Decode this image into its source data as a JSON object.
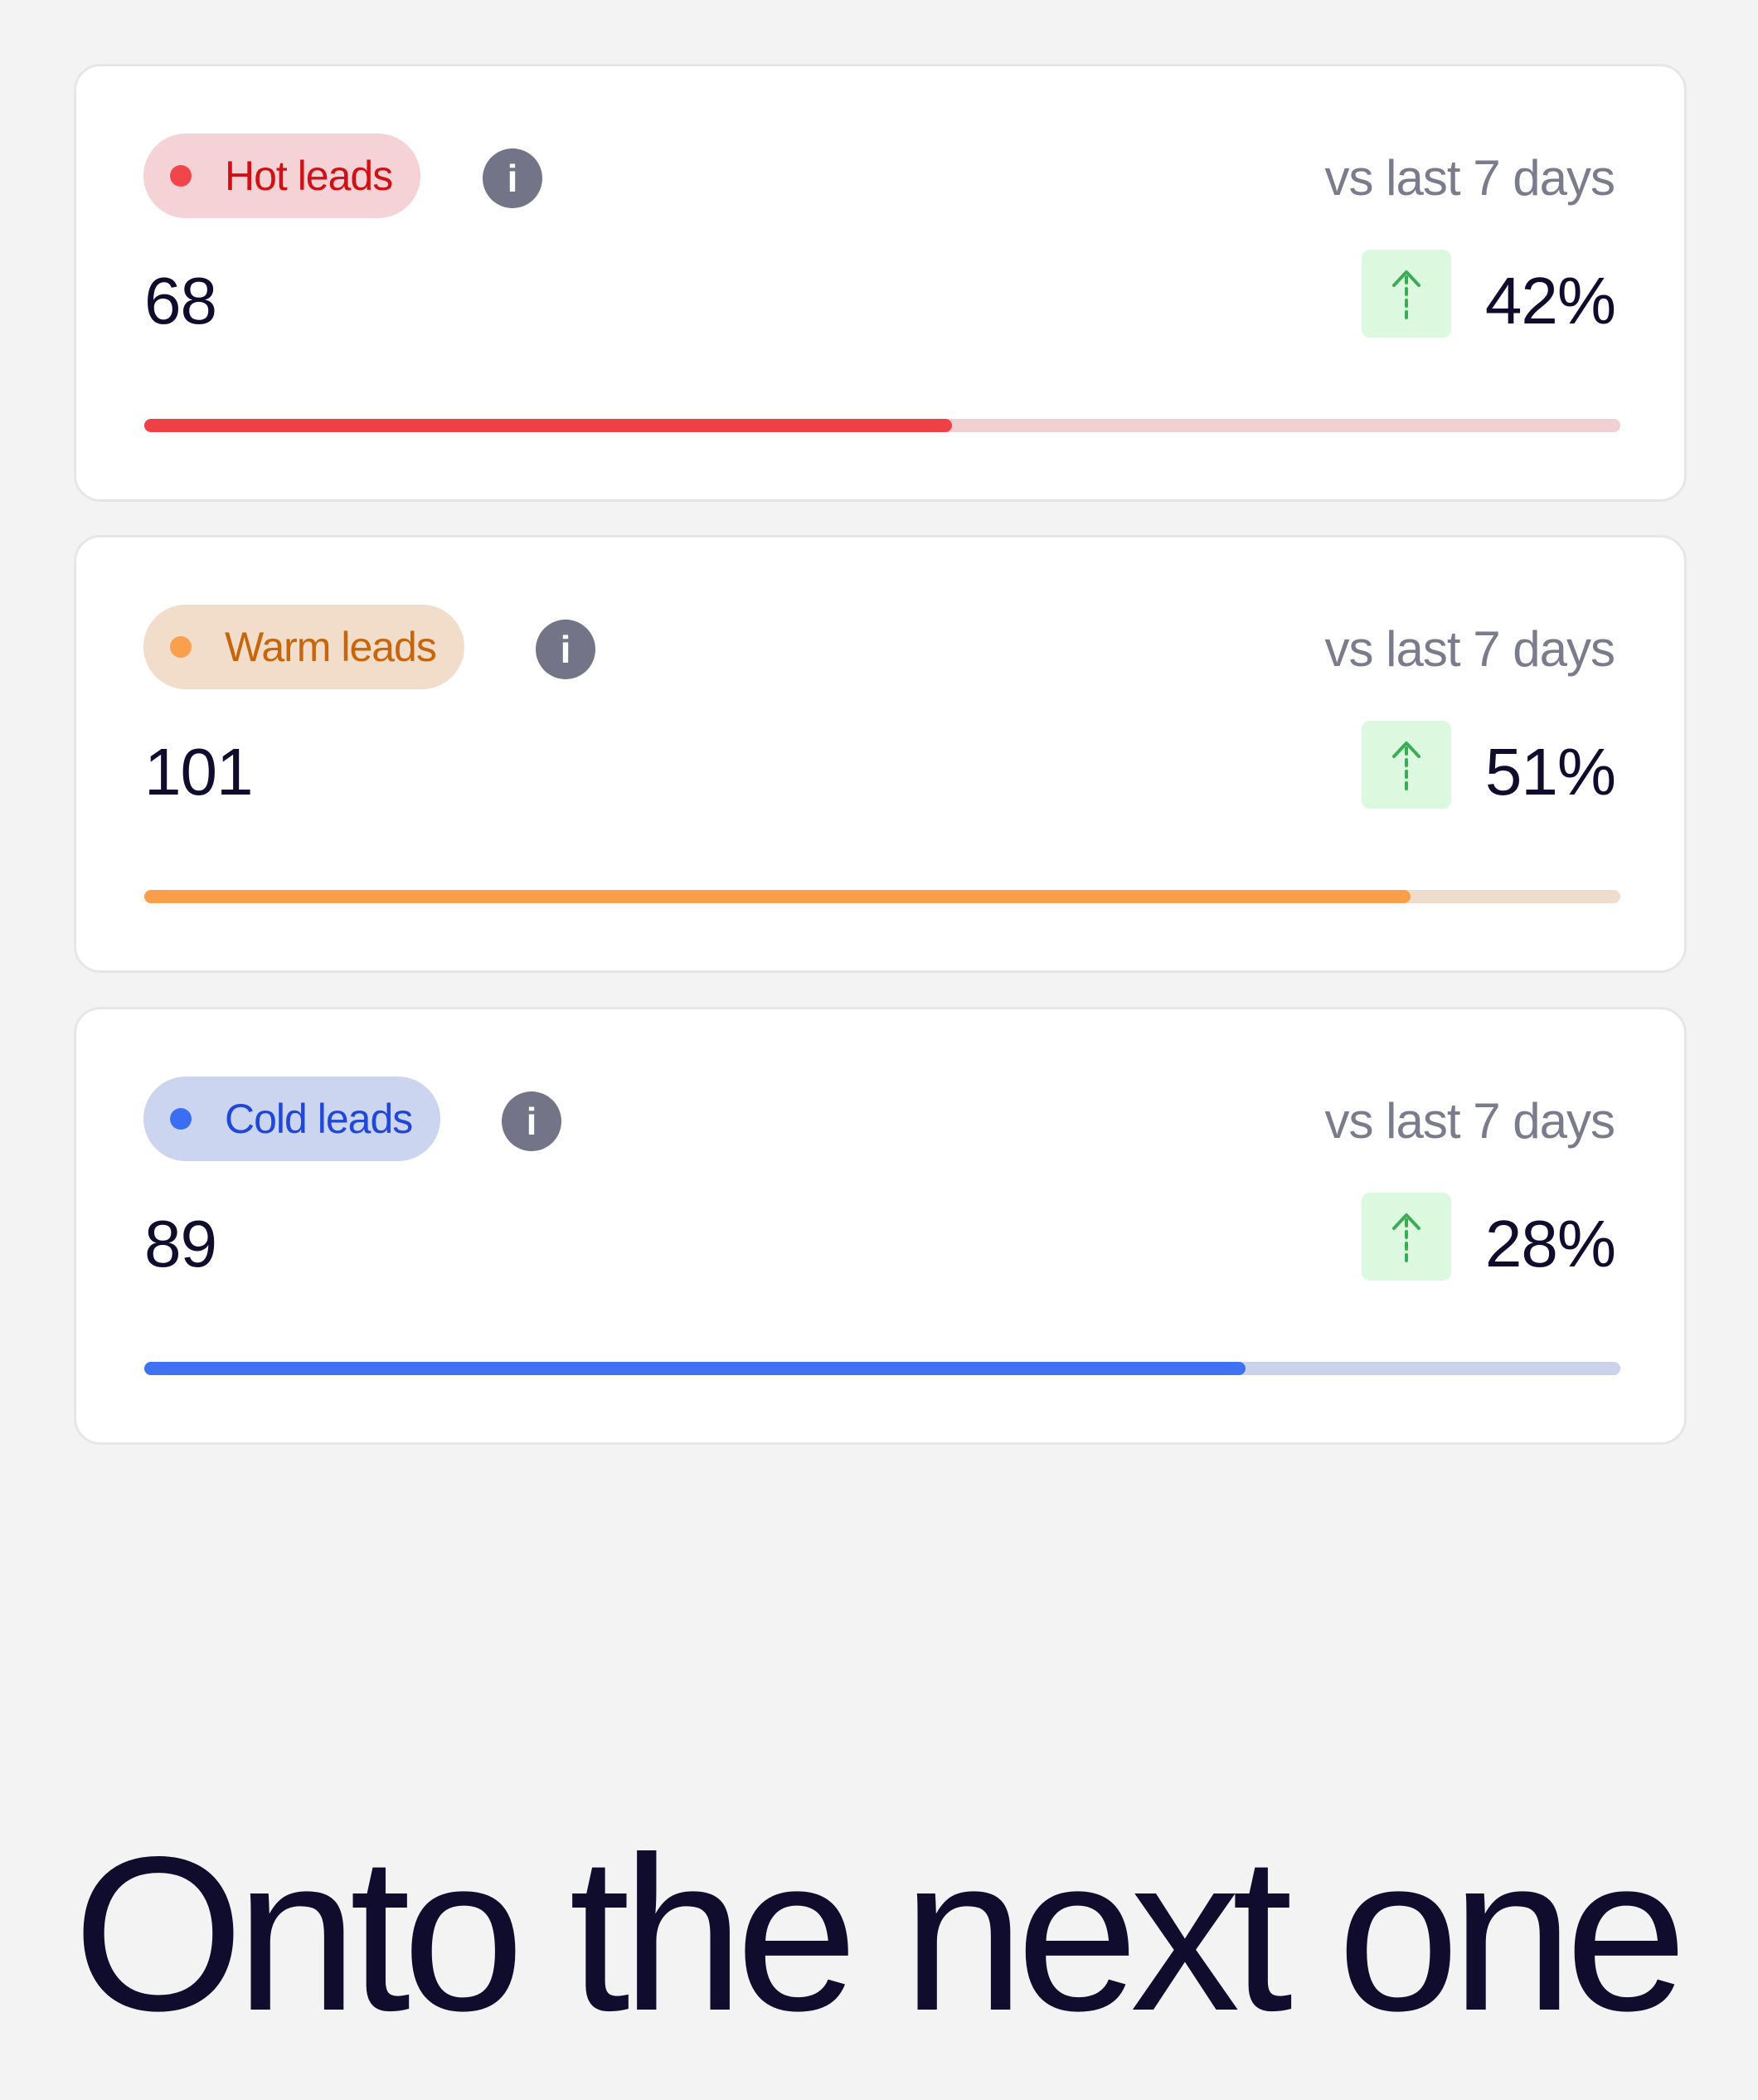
{
  "cards": [
    {
      "label": "Hot leads",
      "period": "vs last 7 days",
      "count": "68",
      "change": "42%",
      "trend": "up",
      "progress": 0.547,
      "colors": {
        "pill_bg": "#f5d2d6",
        "label": "#cf1014",
        "dot": "#f0454b",
        "fill": "#ef4046",
        "track": "#f1cfd3"
      }
    },
    {
      "label": "Warm leads",
      "period": "vs last 7 days",
      "count": "101",
      "change": "51%",
      "trend": "up",
      "progress": 0.858,
      "colors": {
        "pill_bg": "#f1ddca",
        "label": "#c8650c",
        "dot": "#fb9e4d",
        "fill": "#fa9e49",
        "track": "#efdccd"
      }
    },
    {
      "label": "Cold leads",
      "period": "vs last 7 days",
      "count": "89",
      "change": "28%",
      "trend": "up",
      "progress": 0.746,
      "colors": {
        "pill_bg": "#cbd5ef",
        "label": "#2047d9",
        "dot": "#3c6ef4",
        "fill": "#3f72f2",
        "track": "#cbd3ec"
      }
    }
  ],
  "info_glyph": "i",
  "icons": {
    "info": "info-icon",
    "trend": "arrow-up-icon"
  },
  "headline": "Onto the next one"
}
